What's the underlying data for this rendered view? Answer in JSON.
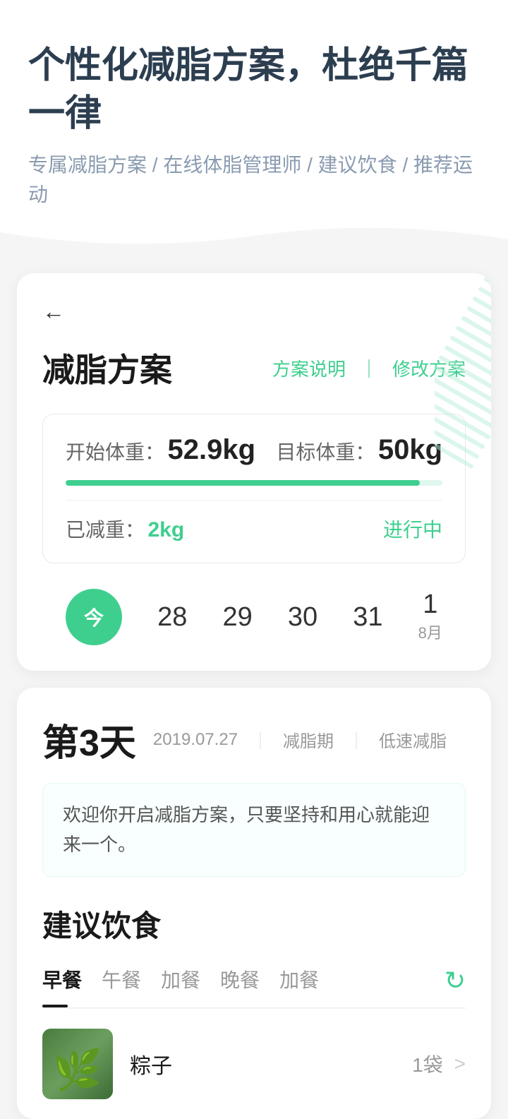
{
  "header": {
    "title": "个性化减脂方案，杜绝千篇一律",
    "subtitle": "专属减脂方案 / 在线体脂管理师 / 建议饮食 / 推荐运动"
  },
  "plan_card": {
    "back_label": "←",
    "title": "减脂方案",
    "action_explain": "方案说明",
    "action_divider": "｜",
    "action_modify": "修改方案",
    "start_weight_label": "开始体重：",
    "start_weight_value": "52.9kg",
    "target_weight_label": "目标体重：",
    "target_weight_value": "50kg",
    "progress_percent": 94,
    "lost_label": "已减重：",
    "lost_value": "2kg",
    "status": "进行中"
  },
  "calendar": {
    "today_label": "今",
    "days": [
      "28",
      "29",
      "30",
      "31"
    ],
    "next_day": "1",
    "next_month": "8月"
  },
  "day_section": {
    "day_number": "第3天",
    "date": "2019.07.27",
    "sep": "｜",
    "period": "减脂期",
    "type": "低速减脂",
    "welcome_text": "欢迎你开启减脂方案，只要坚持和用心就能迎来一个。",
    "diet_title": "建议饮食",
    "tabs": [
      "早餐",
      "午餐",
      "加餐",
      "晚餐",
      "加餐"
    ],
    "active_tab_index": 0,
    "refresh_icon": "↻",
    "meal_name": "粽子",
    "meal_qty": "1袋",
    "meal_arrow": ">"
  },
  "colors": {
    "green": "#3ecf8e",
    "dark": "#1a1a1a",
    "gray": "#999",
    "light_green_bg": "#e0f7ee"
  }
}
